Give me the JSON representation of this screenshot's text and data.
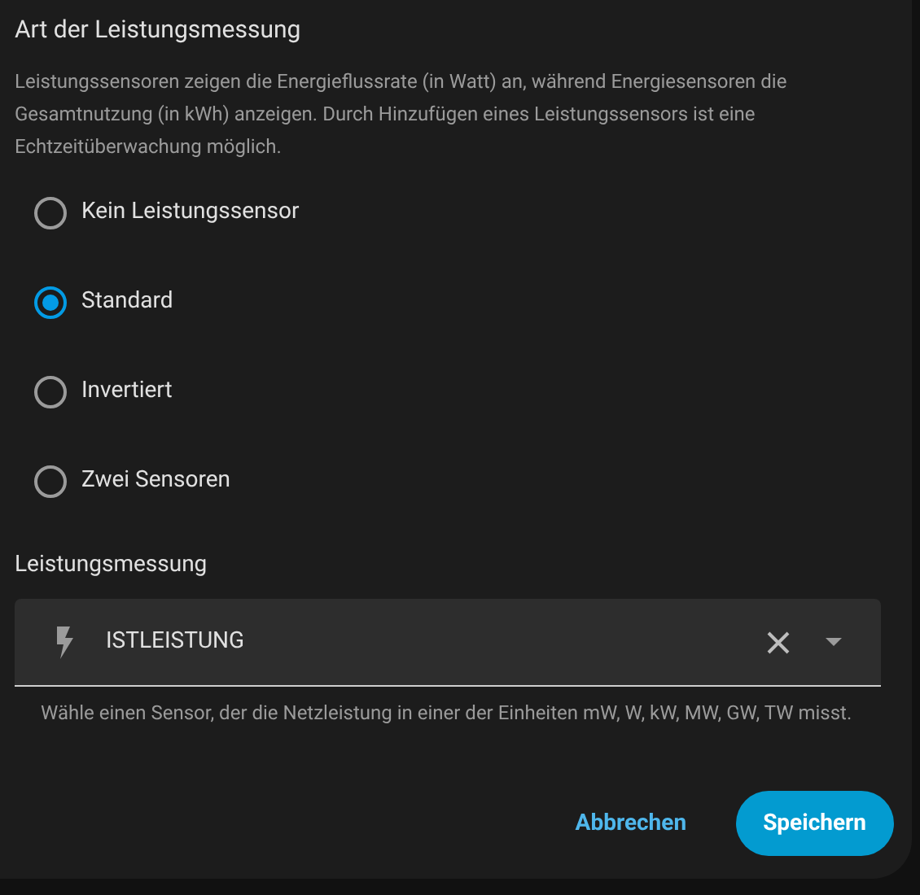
{
  "title": "Art der Leistungsmessung",
  "description": "Leistungssensoren zeigen die Energieflussrate (in Watt) an, während Energiesensoren die Gesamtnutzung (in kWh) anzeigen. Durch Hinzufügen eines Leistungssensors ist eine Echtzeitüberwachung möglich.",
  "options": [
    {
      "label": "Kein Leistungssensor",
      "selected": false
    },
    {
      "label": "Standard",
      "selected": true
    },
    {
      "label": "Invertiert",
      "selected": false
    },
    {
      "label": "Zwei Sensoren",
      "selected": false
    }
  ],
  "sensor_section": {
    "label": "Leistungsmessung",
    "value": "ISTLEISTUNG",
    "helper": "Wähle einen Sensor, der die Netzleistung in einer der Einheiten mW, W, kW, MW, GW, TW misst."
  },
  "buttons": [
    {
      "label": "Abbrechen",
      "kind": "text"
    },
    {
      "label": "Speichern",
      "kind": "filled"
    }
  ]
}
